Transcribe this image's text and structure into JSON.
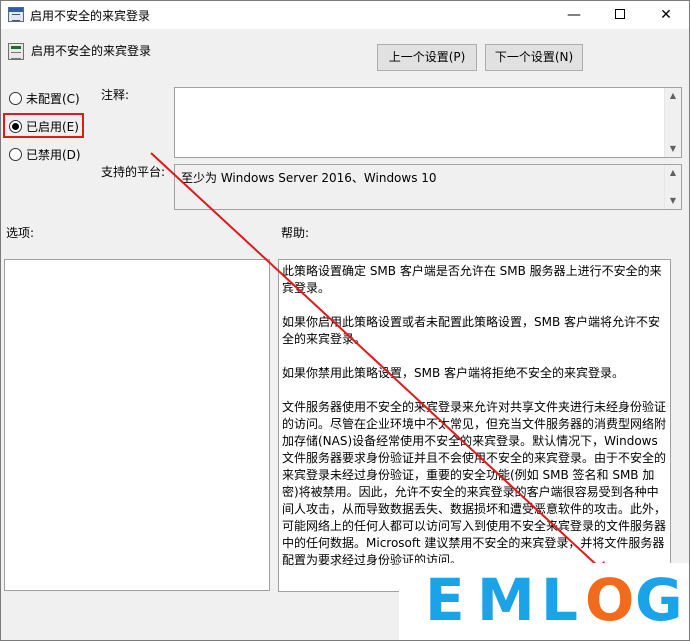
{
  "window": {
    "title": "启用不安全的来宾登录",
    "minimize_glyph": "—",
    "close_glyph": "✕"
  },
  "header": {
    "policy_title": "启用不安全的来宾登录",
    "prev_button": "上一个设置(P)",
    "next_button": "下一个设置(N)"
  },
  "state": {
    "options": [
      {
        "label": "未配置(C)",
        "checked": false
      },
      {
        "label": "已启用(E)",
        "checked": true
      },
      {
        "label": "已禁用(D)",
        "checked": false
      }
    ],
    "highlight_color": "#e11a1a"
  },
  "labels": {
    "comment": "注释:",
    "supported_on": "支持的平台:",
    "options": "选项:",
    "help": "帮助:"
  },
  "comment_value": "",
  "supported_on_value": "至少为 Windows Server 2016、Windows 10",
  "help": {
    "paragraphs": [
      "此策略设置确定 SMB 客户端是否允许在 SMB 服务器上进行不安全的来宾登录。",
      "如果你启用此策略设置或者未配置此策略设置，SMB 客户端将允许不安全的来宾登录。",
      "如果你禁用此策略设置，SMB 客户端将拒绝不安全的来宾登录。",
      "文件服务器使用不安全的来宾登录来允许对共享文件夹进行未经身份验证的访问。尽管在企业环境中不太常见，但充当文件服务器的消费型网络附加存储(NAS)设备经常使用不安全的来宾登录。默认情况下，Windows 文件服务器要求身份验证并且不会使用不安全的来宾登录。由于不安全的来宾登录未经过身份验证，重要的安全功能(例如 SMB 签名和 SMB 加密)将被禁用。因此，允许不安全的来宾登录的客户端很容易受到各种中间人攻击，从而导致数据丢失、数据损坏和遭受恶意软件的攻击。此外，可能网络上的任何人都可以访问写入到使用不安全来宾登录的文件服务器中的任何数据。Microsoft 建议禁用不安全的来宾登录，并将文件服务器配置为要求经过身份验证的访问。"
    ]
  },
  "watermark": {
    "letters": [
      "E",
      "M",
      "L",
      "O",
      "G"
    ],
    "colors": [
      "#1aa3e8",
      "#1aa3e8",
      "#1aa3e8",
      "#f26b1d",
      "#1aa3e8"
    ]
  },
  "annotation": {
    "arrow_color": "#e11a1a"
  }
}
